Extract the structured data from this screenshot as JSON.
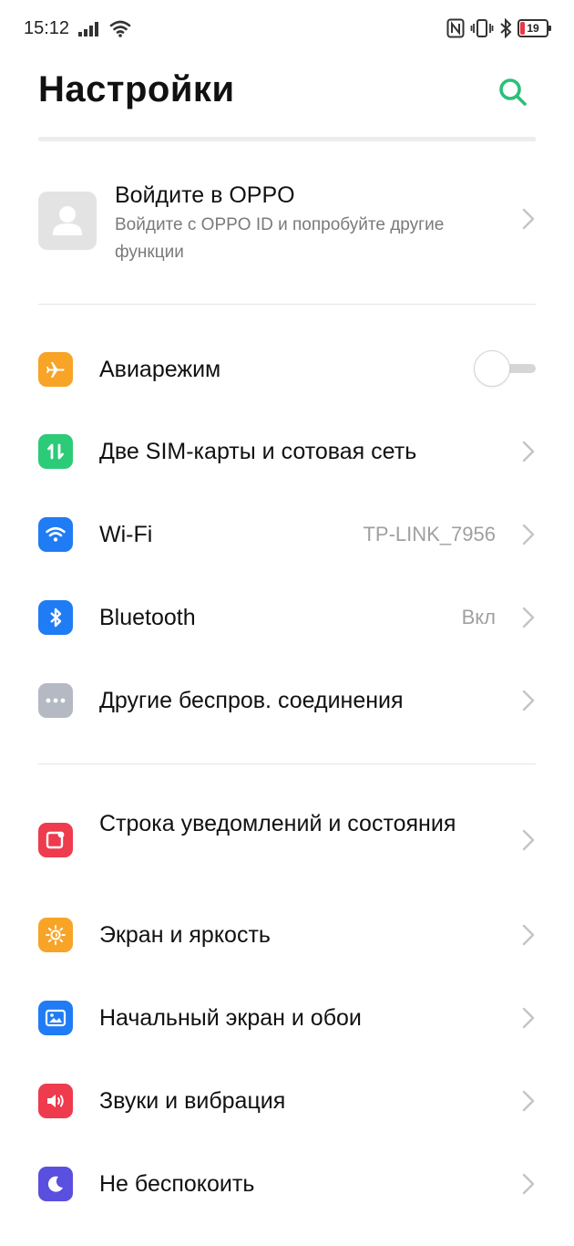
{
  "status_bar": {
    "time": "15:12",
    "battery_level": "19",
    "icons": [
      "signal-icon",
      "wifi-icon",
      "nfc-icon",
      "vibrate-icon",
      "bluetooth-icon",
      "battery-icon"
    ]
  },
  "header": {
    "title": "Настройки",
    "search_icon": "search-icon",
    "accent": "#2bbf7a"
  },
  "account": {
    "title": "Войдите в OPPO",
    "subtitle": "Войдите с OPPO ID и попробуйте другие функции"
  },
  "connectivity": [
    {
      "label": "Авиарежим",
      "icon": "airplane-icon",
      "color": "#f7a427",
      "toggle": false
    },
    {
      "label": "Две SIM-карты и сотовая сеть",
      "icon": "sim-icon",
      "color": "#2bcb77"
    },
    {
      "label": "Wi-Fi",
      "value": "TP-LINK_7956",
      "icon": "wifi-icon",
      "color": "#1f7cf5"
    },
    {
      "label": "Bluetooth",
      "value": "Вкл",
      "icon": "bluetooth-icon",
      "color": "#1f7cf5"
    },
    {
      "label": "Другие беспров. соединения",
      "icon": "more-icon",
      "color": "#b4b9c4"
    }
  ],
  "system": [
    {
      "label": "Строка уведомлений и состояния",
      "icon": "notification-icon",
      "color": "#ee3b4d"
    },
    {
      "label": "Экран и яркость",
      "icon": "brightness-icon",
      "color": "#f7a427"
    },
    {
      "label": "Начальный экран и обои",
      "icon": "wallpaper-icon",
      "color": "#1f7cf5"
    },
    {
      "label": "Звуки и вибрация",
      "icon": "sound-icon",
      "color": "#ee3b4d"
    },
    {
      "label": "Не беспокоить",
      "icon": "moon-icon",
      "color": "#5b4fe0"
    }
  ]
}
